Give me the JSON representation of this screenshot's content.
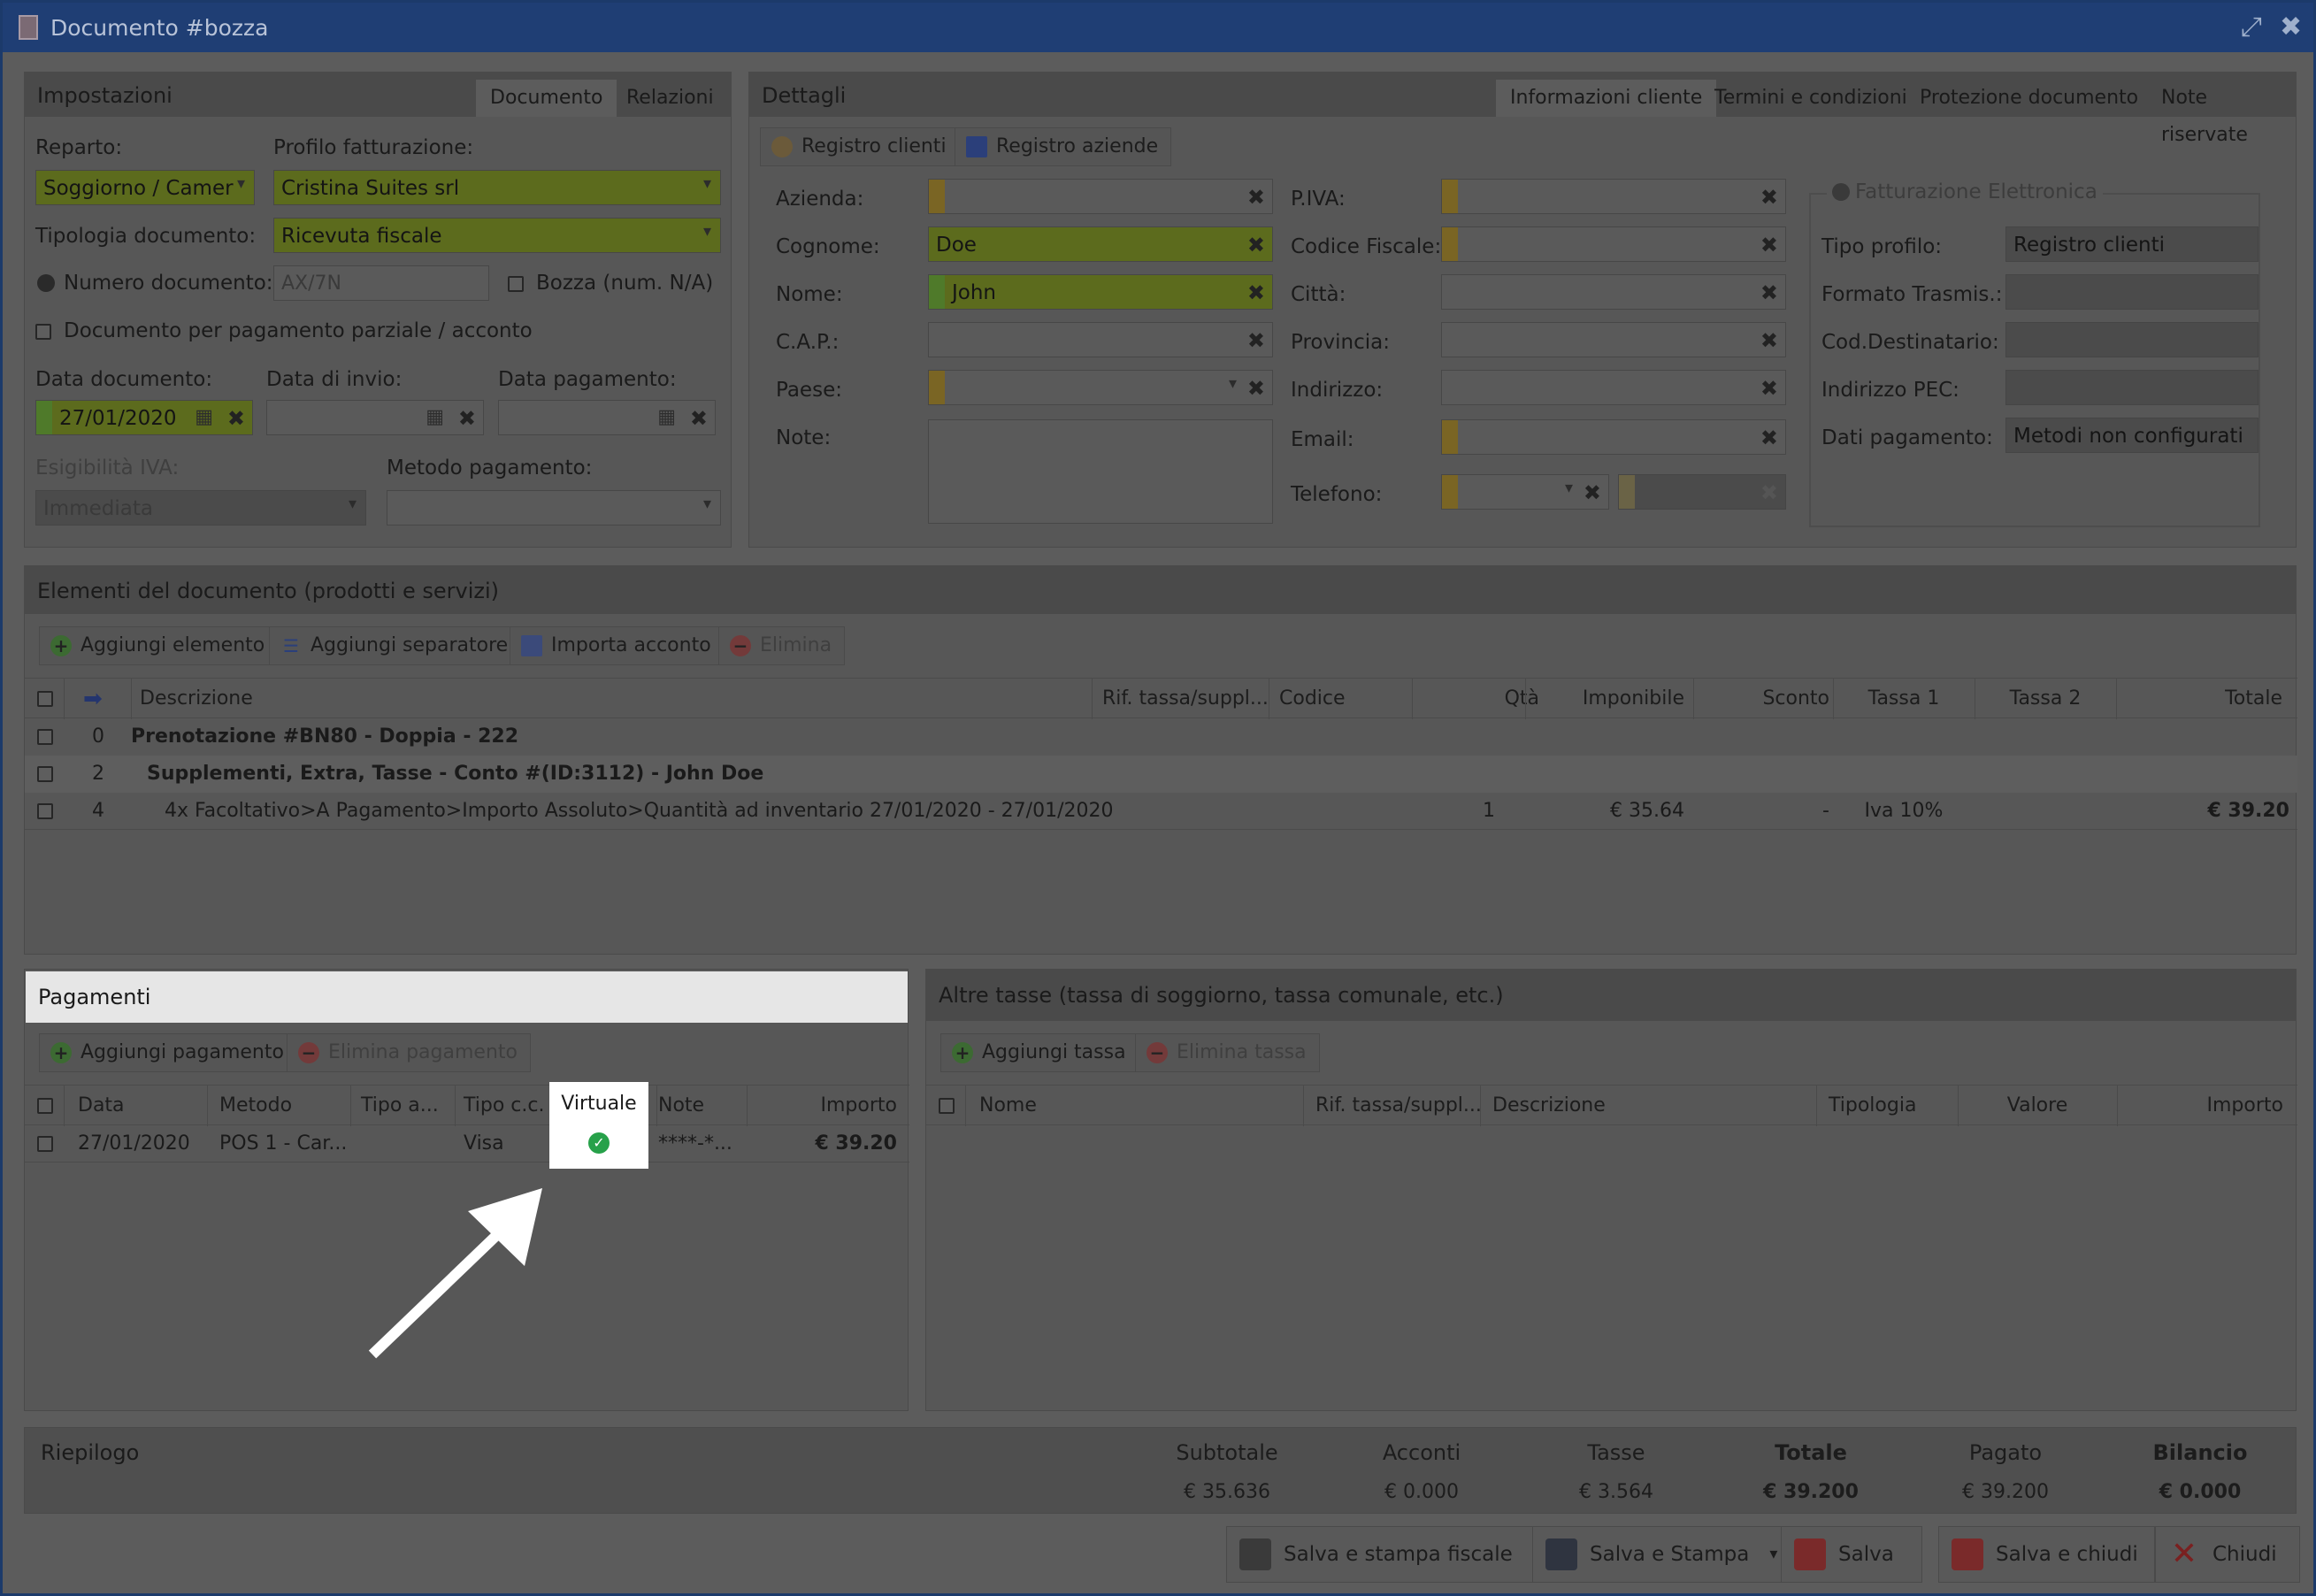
{
  "window": {
    "title": "Documento #bozza"
  },
  "settings": {
    "title": "Impostazioni",
    "tabs": [
      "Documento",
      "Relazioni"
    ],
    "labels": {
      "reparto": "Reparto:",
      "profilo": "Profilo fatturazione:",
      "tipologia": "Tipologia documento:",
      "numero": "Numero documento:",
      "bozza": "Bozza (num. N/A)",
      "parziale": "Documento per pagamento parziale / acconto",
      "data_doc": "Data documento:",
      "data_invio": "Data di invio:",
      "data_pag": "Data pagamento:",
      "esigibilita": "Esigibilità IVA:",
      "metodo": "Metodo pagamento:"
    },
    "values": {
      "reparto": "Soggiorno / Camer",
      "profilo": "Cristina Suites srl",
      "tipologia": "Ricevuta fiscale",
      "numero_placeholder": "AX/7N",
      "data_doc": "27/01/2020",
      "esigibilita": "Immediata"
    }
  },
  "details": {
    "title": "Dettagli",
    "tabs": [
      "Informazioni cliente",
      "Termini e condizioni",
      "Protezione documento",
      "Note riservate"
    ],
    "buttons": {
      "registro_clienti": "Registro clienti",
      "registro_aziende": "Registro aziende"
    },
    "labels": {
      "azienda": "Azienda:",
      "cognome": "Cognome:",
      "nome": "Nome:",
      "cap": "C.A.P.:",
      "paese": "Paese:",
      "note": "Note:",
      "piva": "P.IVA:",
      "cf": "Codice Fiscale:",
      "citta": "Città:",
      "provincia": "Provincia:",
      "indirizzo": "Indirizzo:",
      "email": "Email:",
      "telefono": "Telefono:"
    },
    "values": {
      "cognome": "Doe",
      "nome": "John"
    },
    "fe": {
      "legend": "Fatturazione Elettronica",
      "labels": {
        "tipo": "Tipo profilo:",
        "formato": "Formato Trasmis.:",
        "cod": "Cod.Destinatario:",
        "pec": "Indirizzo PEC:",
        "dati": "Dati pagamento:"
      },
      "values": {
        "tipo": "Registro clienti",
        "dati": "Metodi non configurati"
      }
    }
  },
  "items": {
    "title": "Elementi del documento (prodotti e servizi)",
    "buttons": {
      "add": "Aggiungi elemento",
      "sep": "Aggiungi separatore",
      "import": "Importa acconto",
      "delete": "Elimina"
    },
    "columns": [
      "Descrizione",
      "Rif. tassa/suppl...",
      "Codice",
      "Qtà",
      "Imponibile",
      "Sconto",
      "Tassa 1",
      "Tassa 2",
      "Totale"
    ],
    "rows": [
      {
        "n": "0",
        "desc": "Prenotazione #BN80 - Doppia - 222"
      },
      {
        "n": "2",
        "desc": "Supplementi, Extra, Tasse - Conto #(ID:3112) - John Doe"
      },
      {
        "n": "4",
        "desc": "4x Facoltativo>A Pagamento>Importo Assoluto>Quantità ad inventario 27/01/2020 - 27/01/2020",
        "qta": "1",
        "imponibile": "€ 35.64",
        "sconto": "-",
        "tassa1": "Iva 10%",
        "totale": "€ 39.20"
      }
    ]
  },
  "payments": {
    "title": "Pagamenti",
    "buttons": {
      "add": "Aggiungi pagamento",
      "delete": "Elimina pagamento"
    },
    "columns": [
      "Data",
      "Metodo",
      "Tipo a...",
      "Tipo c.c.",
      "Virtuale",
      "Note",
      "Importo"
    ],
    "row": {
      "data": "27/01/2020",
      "metodo": "POS 1 - Car...",
      "tipo_cc": "Visa",
      "note": "****-*...",
      "importo": "€ 39.20"
    }
  },
  "taxes": {
    "title": "Altre tasse (tassa di soggiorno, tassa comunale, etc.)",
    "buttons": {
      "add": "Aggiungi tassa",
      "delete": "Elimina tassa"
    },
    "columns": [
      "Nome",
      "Rif. tassa/suppl...",
      "Descrizione",
      "Tipologia",
      "Valore",
      "Importo"
    ]
  },
  "summary": {
    "title": "Riepilogo",
    "headers": [
      "Subtotale",
      "Acconti",
      "Tasse",
      "Totale",
      "Pagato",
      "Bilancio"
    ],
    "values": [
      "€ 35.636",
      "€ 0.000",
      "€ 3.564",
      "€ 39.200",
      "€ 39.200",
      "€ 0.000"
    ]
  },
  "footer": {
    "buttons": [
      "Salva e stampa fiscale",
      "Salva e Stampa",
      "Salva",
      "Salva e chiudi",
      "Chiudi"
    ]
  }
}
